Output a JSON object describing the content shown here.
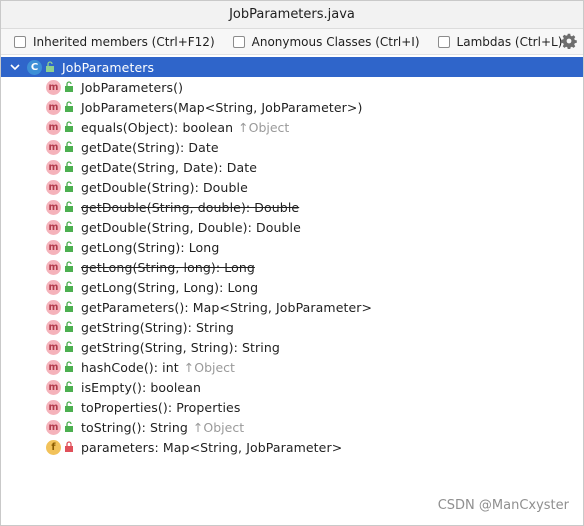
{
  "window": {
    "title": "JobParameters.java"
  },
  "toolbar": {
    "options": [
      {
        "label": "Inherited members (Ctrl+F12)",
        "checked": false
      },
      {
        "label": "Anonymous Classes (Ctrl+I)",
        "checked": false
      },
      {
        "label": "Lambdas (Ctrl+L)",
        "checked": false
      }
    ],
    "settings_icon": "gear-icon"
  },
  "tree": {
    "root": {
      "label": "JobParameters",
      "icon": "class-icon",
      "expanded": true
    },
    "members": [
      {
        "kind": "method",
        "label": "JobParameters()",
        "inherited": "",
        "deprecated": false
      },
      {
        "kind": "method",
        "label": "JobParameters(Map<String, JobParameter>)",
        "inherited": "",
        "deprecated": false
      },
      {
        "kind": "method",
        "label": "equals(Object): boolean",
        "inherited": "↑Object",
        "deprecated": false
      },
      {
        "kind": "method",
        "label": "getDate(String): Date",
        "inherited": "",
        "deprecated": false
      },
      {
        "kind": "method",
        "label": "getDate(String, Date): Date",
        "inherited": "",
        "deprecated": false
      },
      {
        "kind": "method",
        "label": "getDouble(String): Double",
        "inherited": "",
        "deprecated": false
      },
      {
        "kind": "method",
        "label": "getDouble(String, double): Double",
        "inherited": "",
        "deprecated": true
      },
      {
        "kind": "method",
        "label": "getDouble(String, Double): Double",
        "inherited": "",
        "deprecated": false
      },
      {
        "kind": "method",
        "label": "getLong(String): Long",
        "inherited": "",
        "deprecated": false
      },
      {
        "kind": "method",
        "label": "getLong(String, long): Long",
        "inherited": "",
        "deprecated": true
      },
      {
        "kind": "method",
        "label": "getLong(String, Long): Long",
        "inherited": "",
        "deprecated": false
      },
      {
        "kind": "method",
        "label": "getParameters(): Map<String, JobParameter>",
        "inherited": "",
        "deprecated": false
      },
      {
        "kind": "method",
        "label": "getString(String): String",
        "inherited": "",
        "deprecated": false
      },
      {
        "kind": "method",
        "label": "getString(String, String): String",
        "inherited": "",
        "deprecated": false
      },
      {
        "kind": "method",
        "label": "hashCode(): int",
        "inherited": "↑Object",
        "deprecated": false
      },
      {
        "kind": "method",
        "label": "isEmpty(): boolean",
        "inherited": "",
        "deprecated": false
      },
      {
        "kind": "method",
        "label": "toProperties(): Properties",
        "inherited": "",
        "deprecated": false
      },
      {
        "kind": "method",
        "label": "toString(): String",
        "inherited": "↑Object",
        "deprecated": false
      },
      {
        "kind": "field",
        "label": "parameters: Map<String, JobParameter>",
        "inherited": "",
        "deprecated": false
      }
    ]
  },
  "watermark": "CSDN @ManCxyster",
  "colors": {
    "selection": "#2f65ca",
    "method_badge": "#f5b3bb",
    "field_badge": "#f2c25a",
    "public_lock": "#4caf50",
    "private_lock": "#e0505a"
  }
}
